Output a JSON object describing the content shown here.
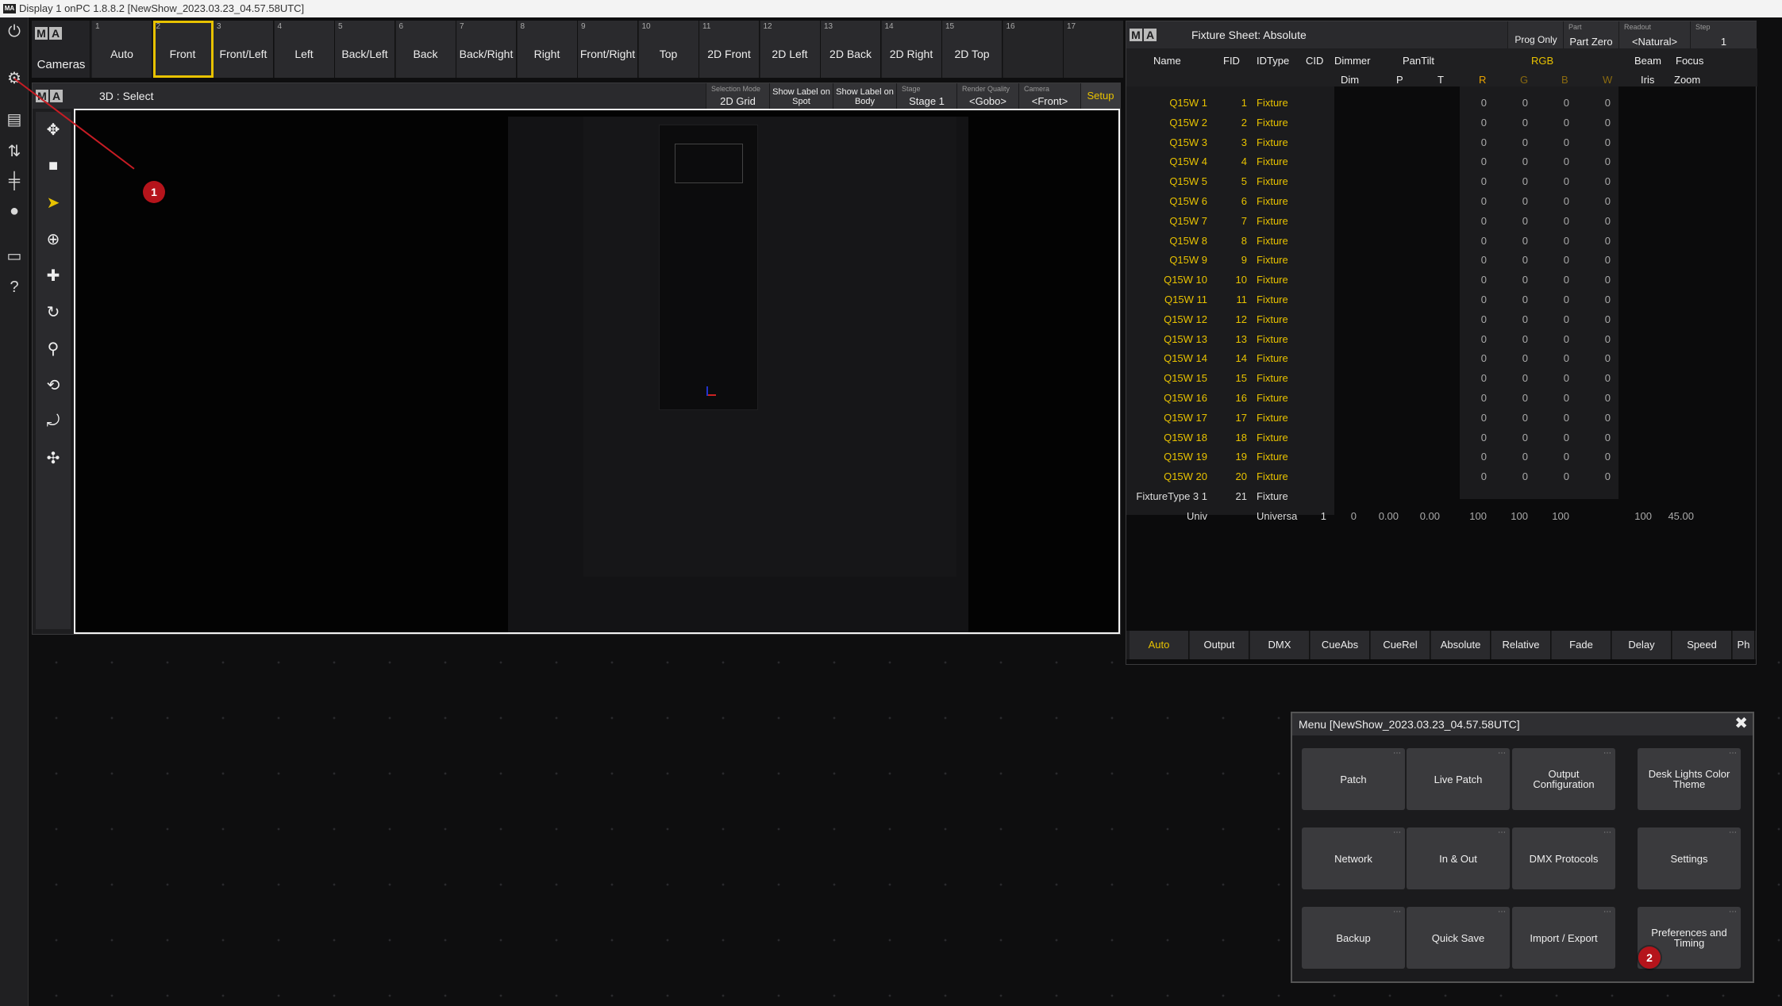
{
  "titlebar": {
    "logo": "MA",
    "title": "Display 1 onPC 1.8.8.2 [NewShow_2023.03.23_04.57.58UTC]"
  },
  "sidebar": {
    "icons": [
      "power-icon",
      "gear-icon",
      "layers-icon",
      "sliders-icon",
      "faders-icon",
      "users-icon",
      "monitor-icon",
      "help-icon"
    ]
  },
  "cameras": {
    "label": "Cameras",
    "buttons": [
      {
        "num": "1",
        "label": "Auto"
      },
      {
        "num": "2",
        "label": "Front"
      },
      {
        "num": "3",
        "label": "Front/Left"
      },
      {
        "num": "4",
        "label": "Left"
      },
      {
        "num": "5",
        "label": "Back/Left"
      },
      {
        "num": "6",
        "label": "Back"
      },
      {
        "num": "7",
        "label": "Back/Right"
      },
      {
        "num": "8",
        "label": "Right"
      },
      {
        "num": "9",
        "label": "Front/Right"
      },
      {
        "num": "10",
        "label": "Top"
      },
      {
        "num": "11",
        "label": "2D Front"
      },
      {
        "num": "12",
        "label": "2D Left"
      },
      {
        "num": "13",
        "label": "2D Back"
      },
      {
        "num": "14",
        "label": "2D Right"
      },
      {
        "num": "15",
        "label": "2D Top"
      },
      {
        "num": "16",
        "label": ""
      },
      {
        "num": "17",
        "label": ""
      }
    ]
  },
  "view3d": {
    "title": "3D : Select",
    "selection_mode": {
      "small": "Selection Mode",
      "value": "2D Grid"
    },
    "show_label_spot": "Show Label on Spot",
    "show_label_body": "Show Label on Body",
    "stage": {
      "small": "Stage",
      "value": "Stage 1"
    },
    "render_quality": {
      "small": "Render Quality",
      "value": "<Gobo>"
    },
    "camera": {
      "small": "Camera",
      "value": "<Front>"
    },
    "setup": "Setup"
  },
  "fixture_sheet": {
    "title": "Fixture Sheet: Absolute",
    "prog_only": "Prog Only",
    "part": {
      "small": "Part",
      "value": "Part Zero"
    },
    "readout": {
      "small": "Readout",
      "value": "<Natural>"
    },
    "step": {
      "small": "Step",
      "value": "1"
    },
    "headers": {
      "name": "Name",
      "fid": "FID",
      "idtype": "IDType",
      "cid": "CID",
      "dimmer": "Dimmer",
      "dim": "Dim",
      "pantilt": "PanTilt",
      "p": "P",
      "t": "T",
      "rgb": "RGB",
      "r": "R",
      "g": "G",
      "b": "B",
      "w": "W",
      "beam": "Beam",
      "iris": "Iris",
      "focus": "Focus",
      "zoom": "Zoom"
    },
    "rows": [
      {
        "name": "Q15W 1",
        "fid": "1",
        "type": "Fixture"
      },
      {
        "name": "Q15W 2",
        "fid": "2",
        "type": "Fixture"
      },
      {
        "name": "Q15W 3",
        "fid": "3",
        "type": "Fixture"
      },
      {
        "name": "Q15W 4",
        "fid": "4",
        "type": "Fixture"
      },
      {
        "name": "Q15W 5",
        "fid": "5",
        "type": "Fixture"
      },
      {
        "name": "Q15W 6",
        "fid": "6",
        "type": "Fixture"
      },
      {
        "name": "Q15W 7",
        "fid": "7",
        "type": "Fixture"
      },
      {
        "name": "Q15W 8",
        "fid": "8",
        "type": "Fixture"
      },
      {
        "name": "Q15W 9",
        "fid": "9",
        "type": "Fixture"
      },
      {
        "name": "Q15W 10",
        "fid": "10",
        "type": "Fixture"
      },
      {
        "name": "Q15W 11",
        "fid": "11",
        "type": "Fixture"
      },
      {
        "name": "Q15W 12",
        "fid": "12",
        "type": "Fixture"
      },
      {
        "name": "Q15W 13",
        "fid": "13",
        "type": "Fixture"
      },
      {
        "name": "Q15W 14",
        "fid": "14",
        "type": "Fixture"
      },
      {
        "name": "Q15W 15",
        "fid": "15",
        "type": "Fixture"
      },
      {
        "name": "Q15W 16",
        "fid": "16",
        "type": "Fixture"
      },
      {
        "name": "Q15W 17",
        "fid": "17",
        "type": "Fixture"
      },
      {
        "name": "Q15W 18",
        "fid": "18",
        "type": "Fixture"
      },
      {
        "name": "Q15W 19",
        "fid": "19",
        "type": "Fixture"
      },
      {
        "name": "Q15W 20",
        "fid": "20",
        "type": "Fixture"
      }
    ],
    "rgb_value": "0",
    "fixturetype_row": {
      "name": "FixtureType 3 1",
      "fid": "21",
      "type": "Fixture"
    },
    "univ_row": {
      "name": "Univ",
      "type": "Universa",
      "cid": "1",
      "dim": "0",
      "p": "0.00",
      "t": "0.00",
      "r": "100",
      "g": "100",
      "b": "100",
      "iris": "100",
      "zoom": "45.00"
    },
    "tabs": [
      "Auto",
      "Output",
      "DMX",
      "CueAbs",
      "CueRel",
      "Absolute",
      "Relative",
      "Fade",
      "Delay",
      "Speed",
      "Ph"
    ]
  },
  "menu": {
    "title": "Menu [NewShow_2023.03.23_04.57.58UTC]",
    "buttons": [
      "Patch",
      "Live Patch",
      "Output Configuration",
      "Desk Lights Color Theme",
      "Network",
      "In & Out",
      "DMX Protocols",
      "Settings",
      "Backup",
      "Quick Save",
      "Import / Export",
      "Preferences and Timing"
    ]
  },
  "annotations": {
    "m1": "1",
    "m2": "2"
  },
  "colors": {
    "accent": "#e8c200",
    "marker": "#b5141b"
  }
}
